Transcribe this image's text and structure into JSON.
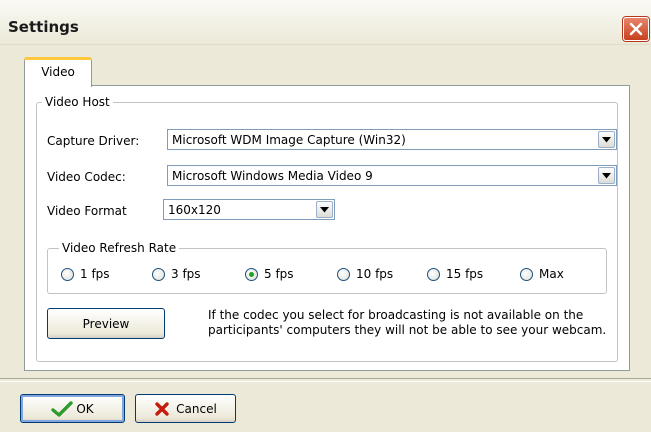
{
  "window": {
    "title": "Settings",
    "close_icon": "close-icon"
  },
  "tabs": [
    {
      "label": "Video",
      "active": true
    }
  ],
  "video_host": {
    "group_label": "Video Host",
    "capture_driver": {
      "label": "Capture Driver:",
      "value": "Microsoft WDM Image Capture (Win32)"
    },
    "video_codec": {
      "label": "Video Codec:",
      "value": "Microsoft Windows Media Video 9"
    },
    "video_format": {
      "label": "Video Format",
      "value": "160x120"
    }
  },
  "refresh_rate": {
    "group_label": "Video Refresh Rate",
    "options": [
      {
        "label": "1 fps",
        "selected": false
      },
      {
        "label": "3 fps",
        "selected": false
      },
      {
        "label": "5 fps",
        "selected": true
      },
      {
        "label": "10 fps",
        "selected": false
      },
      {
        "label": "15 fps",
        "selected": false
      },
      {
        "label": "Max",
        "selected": false
      }
    ]
  },
  "preview": {
    "button_label": "Preview",
    "note": "If the codec you select for broadcasting is not available on the participants' computers they will not be able to see your webcam."
  },
  "footer": {
    "ok_label": "OK",
    "cancel_label": "Cancel"
  },
  "colors": {
    "ok_check": "#2e9a2e",
    "cancel_x": "#c41b0c",
    "selected_radio": "#21a121"
  }
}
